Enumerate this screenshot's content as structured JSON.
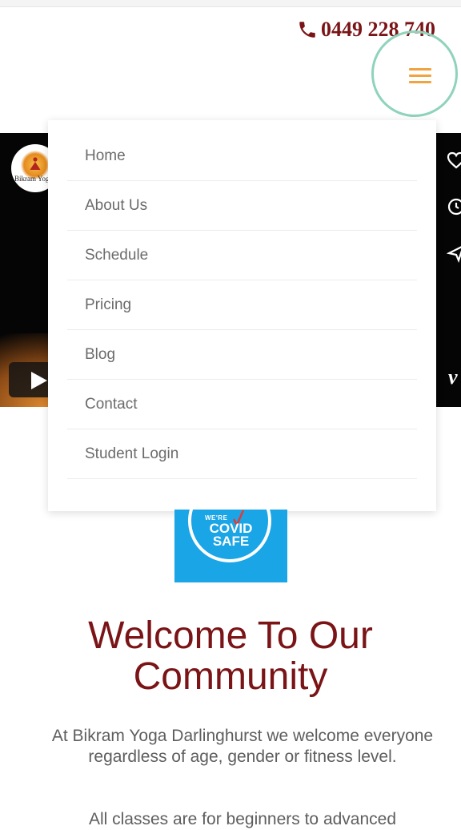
{
  "header": {
    "phone": "0449 228 740",
    "phone_icon": "phone-icon",
    "menu_icon": "hamburger-icon",
    "menu_icon_color": "#f0a33e",
    "focus_ring_color": "#8fd3bb",
    "phone_color": "#7a1416"
  },
  "video": {
    "logo_text": "Bikram Yoga",
    "play_icon": "play-icon",
    "side_icons": [
      "heart-icon",
      "clock-icon",
      "share-icon"
    ],
    "vimeo_mark": "v"
  },
  "nav": {
    "items": [
      {
        "label": "Home"
      },
      {
        "label": "About Us"
      },
      {
        "label": "Schedule"
      },
      {
        "label": "Pricing"
      },
      {
        "label": "Blog"
      },
      {
        "label": "Contact"
      },
      {
        "label": "Student Login"
      }
    ]
  },
  "covid_badge": {
    "small": "WE'RE",
    "line1": "COVID",
    "line2": "SAFE",
    "background": "#1aa5e6"
  },
  "main": {
    "heading": "Welcome To Our Community",
    "intro": "At Bikram Yoga Darlinghurst we welcome everyone regardless of age, gender or fitness level.",
    "intro2": "All classes are for beginners to advanced",
    "accent": "#7a1416"
  }
}
